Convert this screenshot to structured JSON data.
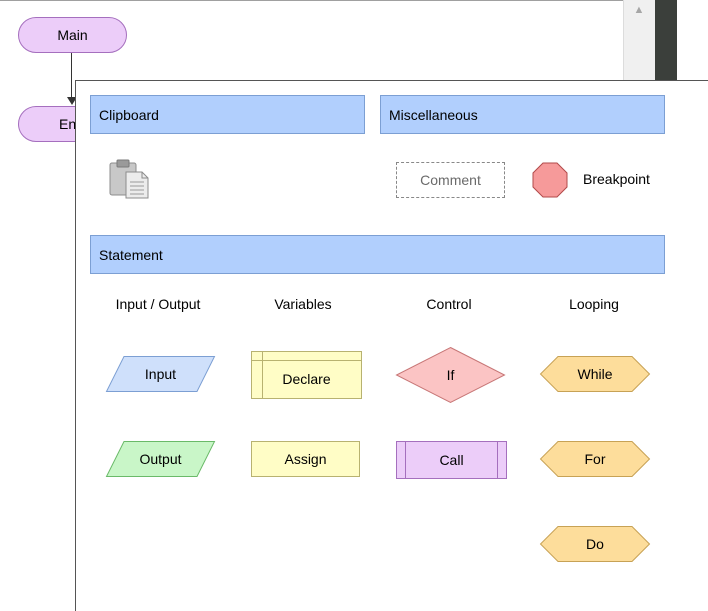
{
  "canvas": {
    "start_node": "Main",
    "end_node": "En"
  },
  "palette": {
    "sections": {
      "clipboard": "Clipboard",
      "miscellaneous": "Miscellaneous",
      "statement": "Statement"
    },
    "misc_items": {
      "comment": "Comment",
      "breakpoint": "Breakpoint"
    },
    "columns": {
      "input_output": "Input / Output",
      "variables": "Variables",
      "control": "Control",
      "looping": "Looping"
    },
    "shapes": {
      "input": "Input",
      "output": "Output",
      "declare": "Declare",
      "assign": "Assign",
      "if": "If",
      "call": "Call",
      "while": "While",
      "for": "For",
      "do": "Do"
    }
  },
  "colors": {
    "section_header": "#b1cffd",
    "terminal": "#eccdf9",
    "input": "#cfe0fb",
    "output": "#c9f6c8",
    "variable": "#fffdc6",
    "if": "#fbc4c4",
    "loop": "#fddd9b",
    "breakpoint": "#f69a9a"
  },
  "icons": {
    "paste": "clipboard-paste-icon",
    "scroll_up": "scroll-up-arrow-icon",
    "breakpoint": "octagon-icon"
  }
}
